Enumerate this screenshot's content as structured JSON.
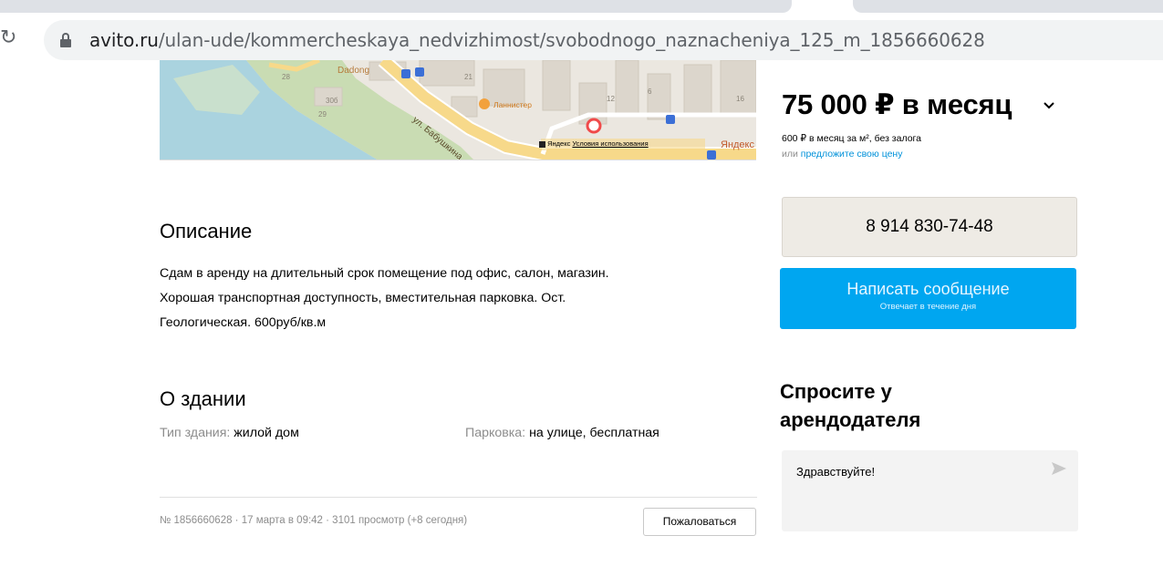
{
  "browser": {
    "url_host": "avito.ru",
    "url_path": "/ulan-ude/kommercheskaya_nedvizhimost/svobodnogo_naznacheniya_125_m_1856660628"
  },
  "map": {
    "labels": {
      "dadong": "Dadong",
      "street": "ул. Бабушкина",
      "lanister": "Ланнистер",
      "yandex": "Яндекс",
      "terms": "Условия использования",
      "watermark": "Яндекс",
      "num_28": "28",
      "num_29": "29",
      "num_30b": "30б",
      "num_21": "21",
      "num_12": "12",
      "num_6": "6",
      "num_16": "16"
    }
  },
  "description": {
    "title": "Описание",
    "lines": [
      "Сдам в аренду на длительный срок помещение под офис, салон, магазин.",
      "Хорошая транспортная доступность, вместительная парковка. Ост.",
      "Геологическая. 600руб/кв.м"
    ]
  },
  "building": {
    "title": "О здании",
    "type_label": "Тип здания:",
    "type_value": "жилой дом",
    "parking_label": "Парковка:",
    "parking_value": "на улице, бесплатная"
  },
  "footer": {
    "meta": "№ 1856660628 · 17 марта в 09:42 · 3101 просмотр (+8 сегодня)",
    "report_label": "Пожаловаться"
  },
  "pricing": {
    "price": "75 000 ₽ в месяц",
    "chevron": "⌄",
    "per_meter": "600 ₽ в месяц за м², без залога",
    "or_prefix": "или",
    "offer_link": "предложите свою цену"
  },
  "contact": {
    "phone": "8 914 830-74-48",
    "message_label": "Написать сообщение",
    "message_sub": "Отвечает в течение дня"
  },
  "ask": {
    "title": "Спросите у арендодателя",
    "input_value": "Здравствуйте!"
  },
  "colors": {
    "accent_blue": "#00a6f0",
    "link_blue": "#0091d9",
    "phone_bg": "#eeebe5",
    "muted_gray": "#8d8d8d"
  }
}
